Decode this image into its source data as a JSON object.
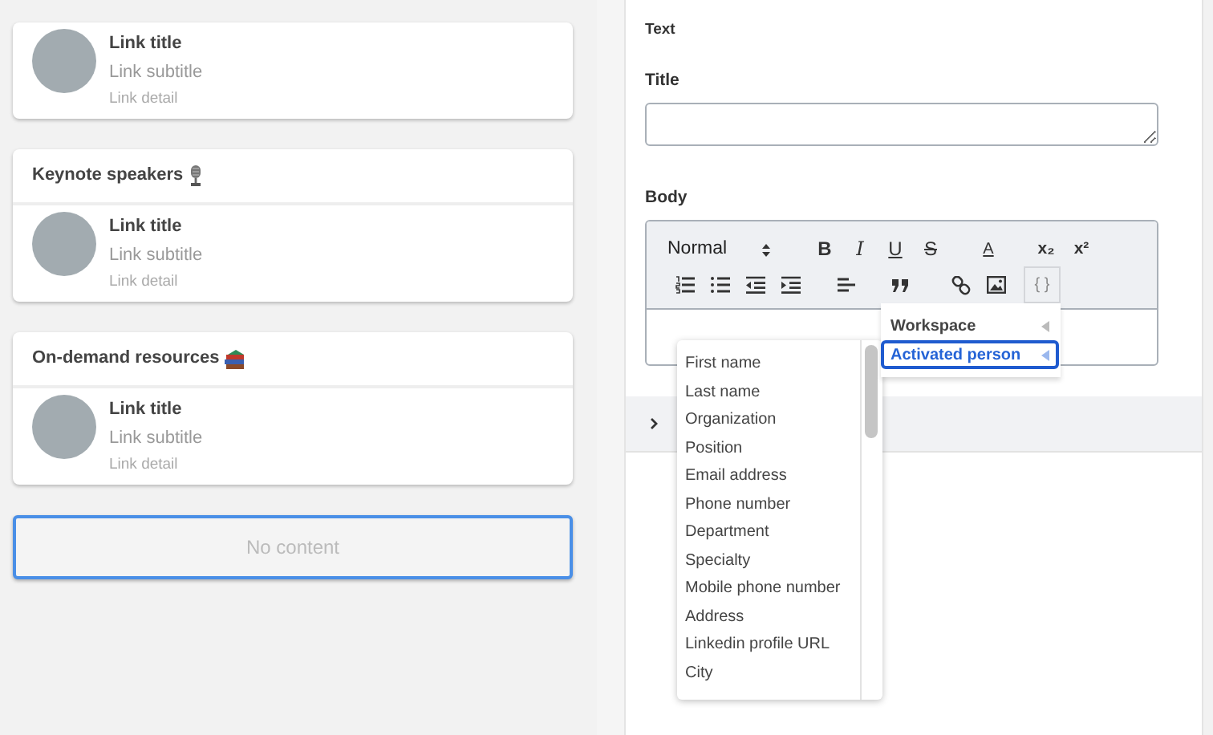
{
  "cards": [
    {
      "link": {
        "title": "Link title",
        "subtitle": "Link subtitle",
        "detail": "Link detail"
      }
    },
    {
      "header": "Keynote speakers",
      "link": {
        "title": "Link title",
        "subtitle": "Link subtitle",
        "detail": "Link detail"
      }
    },
    {
      "header": "On-demand resources",
      "link": {
        "title": "Link title",
        "subtitle": "Link subtitle",
        "detail": "Link detail"
      }
    }
  ],
  "empty_block": {
    "text": "No content",
    "selected": true
  },
  "editor": {
    "section": "Text",
    "title_label": "Title",
    "body_label": "Body",
    "format_select": "Normal",
    "toolbar_row_1": [
      "B",
      "I",
      "U",
      "S",
      "A",
      "x₂",
      "x²"
    ],
    "toolbar_row_2": [
      {
        "kind": "icon"
      },
      {
        "kind": "icon"
      },
      {
        "kind": "icon"
      },
      {
        "kind": "icon"
      },
      {
        "kind": "icon"
      },
      {
        "kind": "icon"
      },
      {
        "kind": "icon"
      },
      {
        "kind": "icon"
      },
      {
        "kind": "text",
        "text": "{ }"
      }
    ],
    "accordion": {
      "expanded": false
    }
  },
  "submenu": [
    {
      "label": "Workspace",
      "selected": false
    },
    {
      "label": "Activated person",
      "selected": true
    }
  ],
  "field_menu": [
    "First name",
    "Last name",
    "Organization",
    "Position",
    "Email address",
    "Phone number",
    "Department",
    "Specialty",
    "Mobile phone number",
    "Address",
    "Linkedin profile URL",
    "City"
  ]
}
